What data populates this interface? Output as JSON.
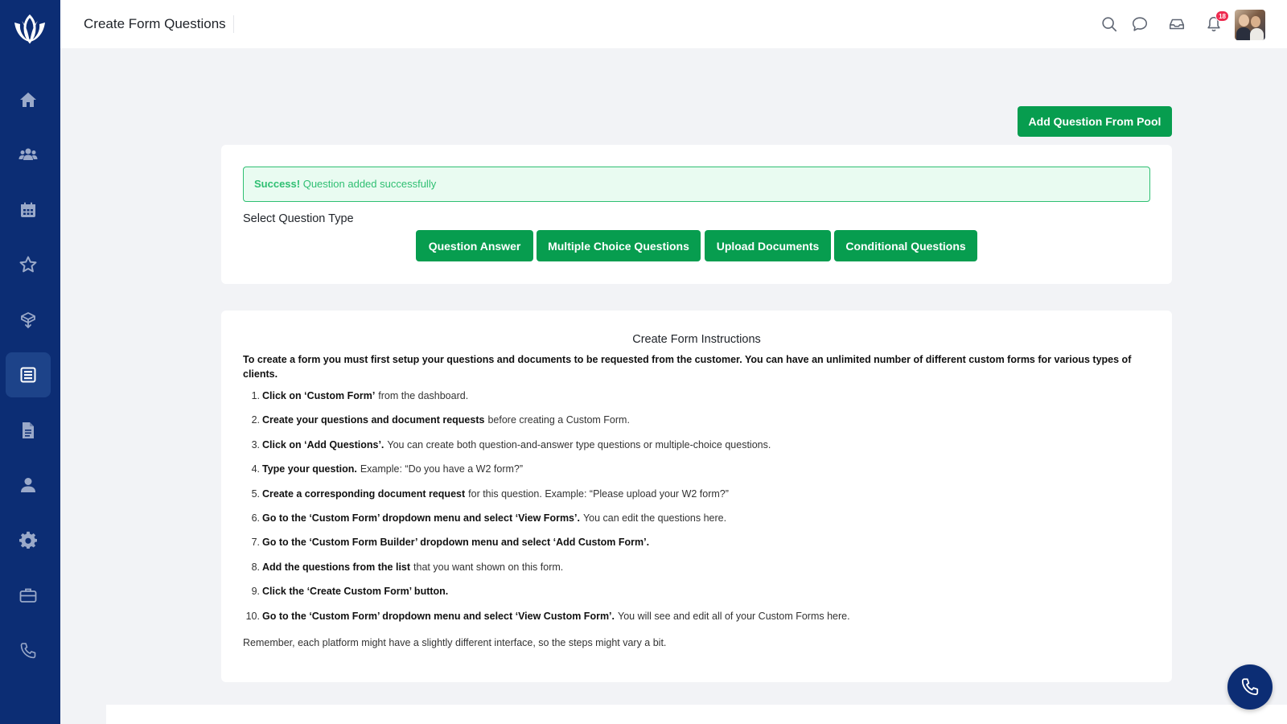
{
  "header": {
    "title": "Create Form Questions",
    "notification_count": "18"
  },
  "sidebar": {
    "items": [
      {
        "name": "home",
        "icon": "home-icon"
      },
      {
        "name": "clients",
        "icon": "users-icon"
      },
      {
        "name": "calendar",
        "icon": "calendar-icon"
      },
      {
        "name": "favorites",
        "icon": "star-icon"
      },
      {
        "name": "packages",
        "icon": "box-icon"
      },
      {
        "name": "forms",
        "icon": "form-icon",
        "active": true
      },
      {
        "name": "documents",
        "icon": "document-icon"
      },
      {
        "name": "profile",
        "icon": "user-icon"
      },
      {
        "name": "settings",
        "icon": "gear-icon"
      },
      {
        "name": "portfolio",
        "icon": "briefcase-icon"
      },
      {
        "name": "calls",
        "icon": "phone-icon"
      }
    ]
  },
  "actions": {
    "add_from_pool": "Add Question From Pool"
  },
  "alert": {
    "strong": "Success!",
    "message": "Question added successfully"
  },
  "question_type": {
    "label": "Select Question Type",
    "buttons": [
      "Question Answer",
      "Multiple Choice Questions",
      "Upload Documents",
      "Conditional Questions"
    ]
  },
  "instructions": {
    "title": "Create Form Instructions",
    "intro": "To create a form you must first setup your questions and documents to be requested from the customer. You can have an unlimited number of different custom forms for various types of clients.",
    "steps": [
      {
        "num": "1.",
        "bold": "Click on ‘Custom Form’",
        "text": "from the dashboard."
      },
      {
        "num": "2.",
        "bold": "Create your questions and document requests",
        "text": "before creating a Custom Form."
      },
      {
        "num": "3.",
        "bold": "Click on ‘Add Questions’.",
        "text": "You can create both question-and-answer type questions or multiple-choice questions."
      },
      {
        "num": "4.",
        "bold": "Type your question.",
        "text": "Example: “Do you have a W2 form?”"
      },
      {
        "num": "5.",
        "bold": "Create a corresponding document request",
        "text": "for this question. Example: “Please upload your W2 form?”"
      },
      {
        "num": "6.",
        "bold": "Go to the ‘Custom Form’ dropdown menu and select ‘View Forms’.",
        "text": "You can edit the questions here."
      },
      {
        "num": "7.",
        "bold": "Go to the ‘Custom Form Builder’ dropdown menu and select ‘Add Custom Form’.",
        "text": ""
      },
      {
        "num": "8.",
        "bold": "Add the questions from the list",
        "text": "that you want shown on this form."
      },
      {
        "num": "9.",
        "bold": "Click the ‘Create Custom Form’ button.",
        "text": ""
      },
      {
        "num": "10.",
        "bold": "Go to the ‘Custom Form’ dropdown menu and select ‘View Custom Form’.",
        "text": "You will see and edit all of your Custom Forms here."
      }
    ],
    "outro": "Remember, each platform might have a slightly different interface, so the steps might vary a bit."
  },
  "colors": {
    "sidebar": "#0c2d74",
    "primary_button": "#079d4f",
    "success_text": "#2fbf72",
    "success_bg": "#e9fbf1",
    "badge": "#ee2a4f"
  }
}
